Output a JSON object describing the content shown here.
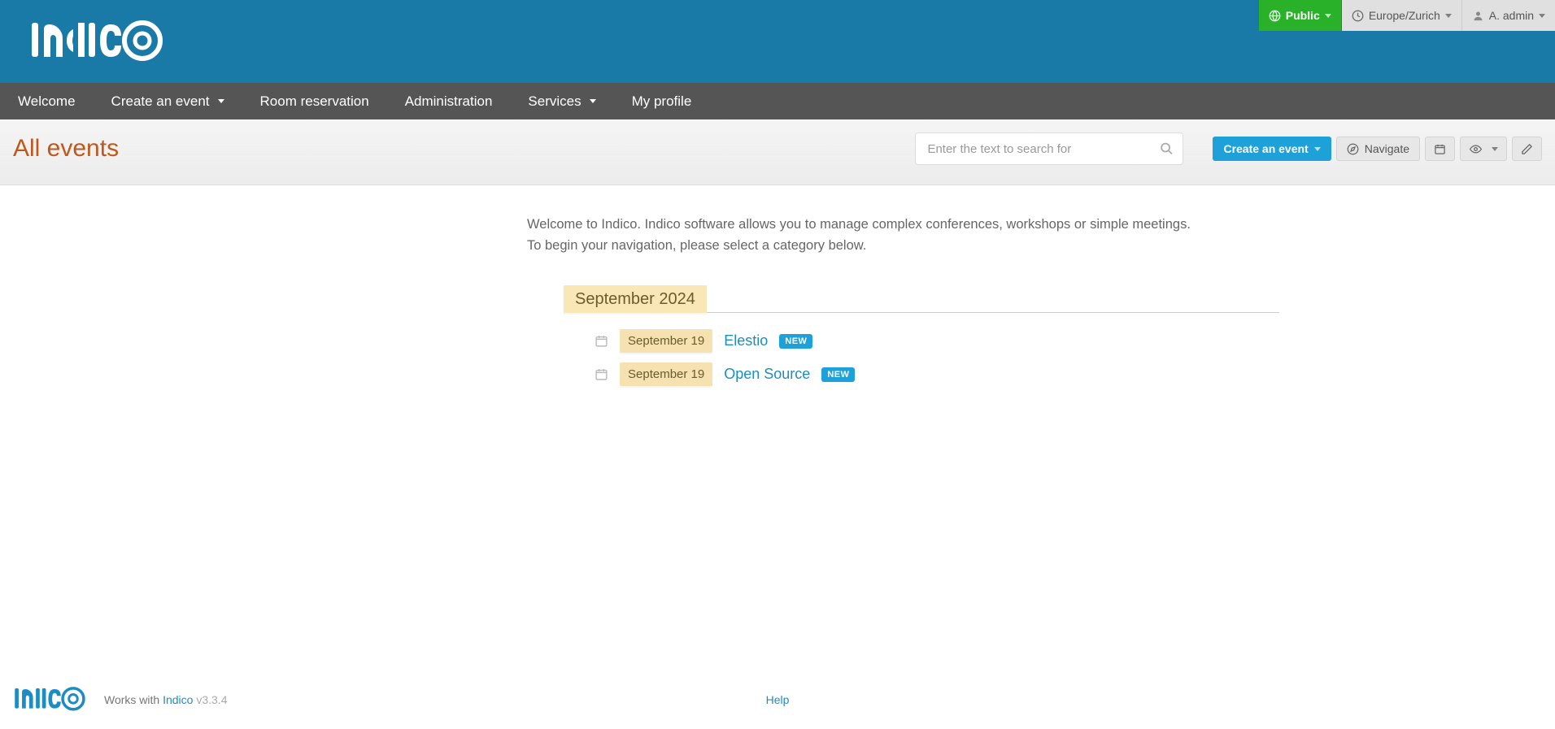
{
  "topbar": {
    "public": "Public",
    "timezone": "Europe/Zurich",
    "user": "A. admin"
  },
  "nav": [
    {
      "label": "Welcome",
      "dropdown": false
    },
    {
      "label": "Create an event",
      "dropdown": true
    },
    {
      "label": "Room reservation",
      "dropdown": false
    },
    {
      "label": "Administration",
      "dropdown": false
    },
    {
      "label": "Services",
      "dropdown": true
    },
    {
      "label": "My profile",
      "dropdown": false
    }
  ],
  "page_title": "All events",
  "search_placeholder": "Enter the text to search for",
  "toolbar": {
    "create_event": "Create an event",
    "navigate": "Navigate"
  },
  "intro": {
    "line1": "Welcome to Indico. Indico software allows you to manage complex conferences, workshops or simple meetings.",
    "line2": "To begin your navigation, please select a category below."
  },
  "month_header": "September 2024",
  "events": [
    {
      "date": "September 19",
      "title": "Elestio",
      "badge": "NEW"
    },
    {
      "date": "September 19",
      "title": "Open Source",
      "badge": "NEW"
    }
  ],
  "footer": {
    "works_with": "Works with",
    "product": "Indico",
    "version": "v3.3.4",
    "help": "Help"
  }
}
